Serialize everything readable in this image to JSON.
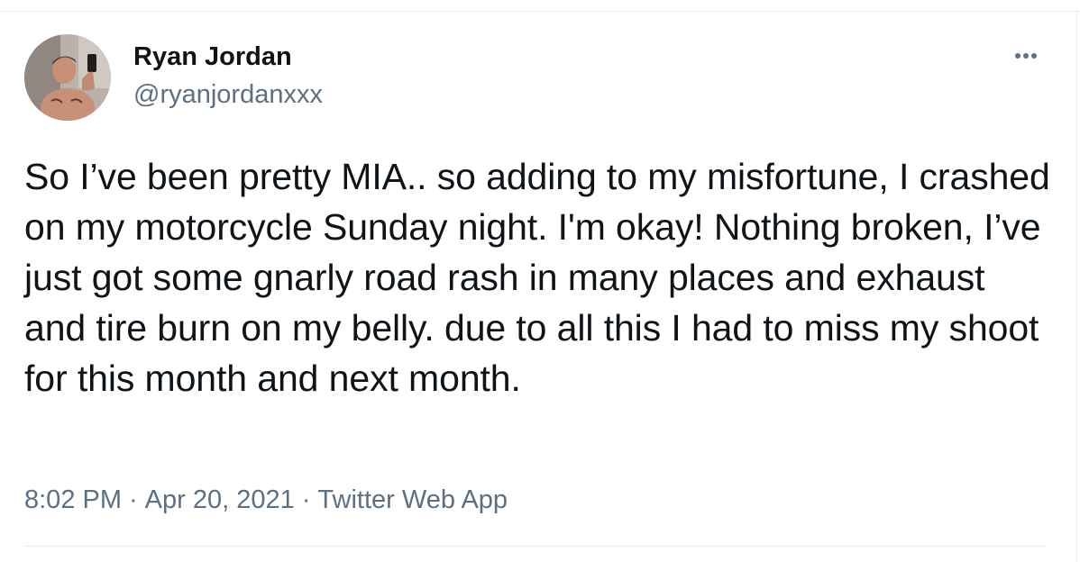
{
  "user": {
    "name": "Ryan Jordan",
    "handle": "@ryanjordanxxx",
    "avatar_icon": "profile-photo"
  },
  "more_icon": "more-horizontal-icon",
  "tweet": {
    "text": "So I’ve been pretty MIA.. so adding to my misfortune, I crashed on my motorcycle Sunday night. I'm okay! Nothing broken, I’ve just got some gnarly road rash in many places and exhaust and tire burn on my belly. due to all this I had to miss my shoot for this month and next month."
  },
  "meta": {
    "time": "8:02 PM",
    "separator": "·",
    "date": "Apr 20, 2021",
    "source": "Twitter Web App"
  },
  "colors": {
    "text": "#0f1419",
    "secondary": "#5b7083",
    "border": "#e6ecf0"
  }
}
